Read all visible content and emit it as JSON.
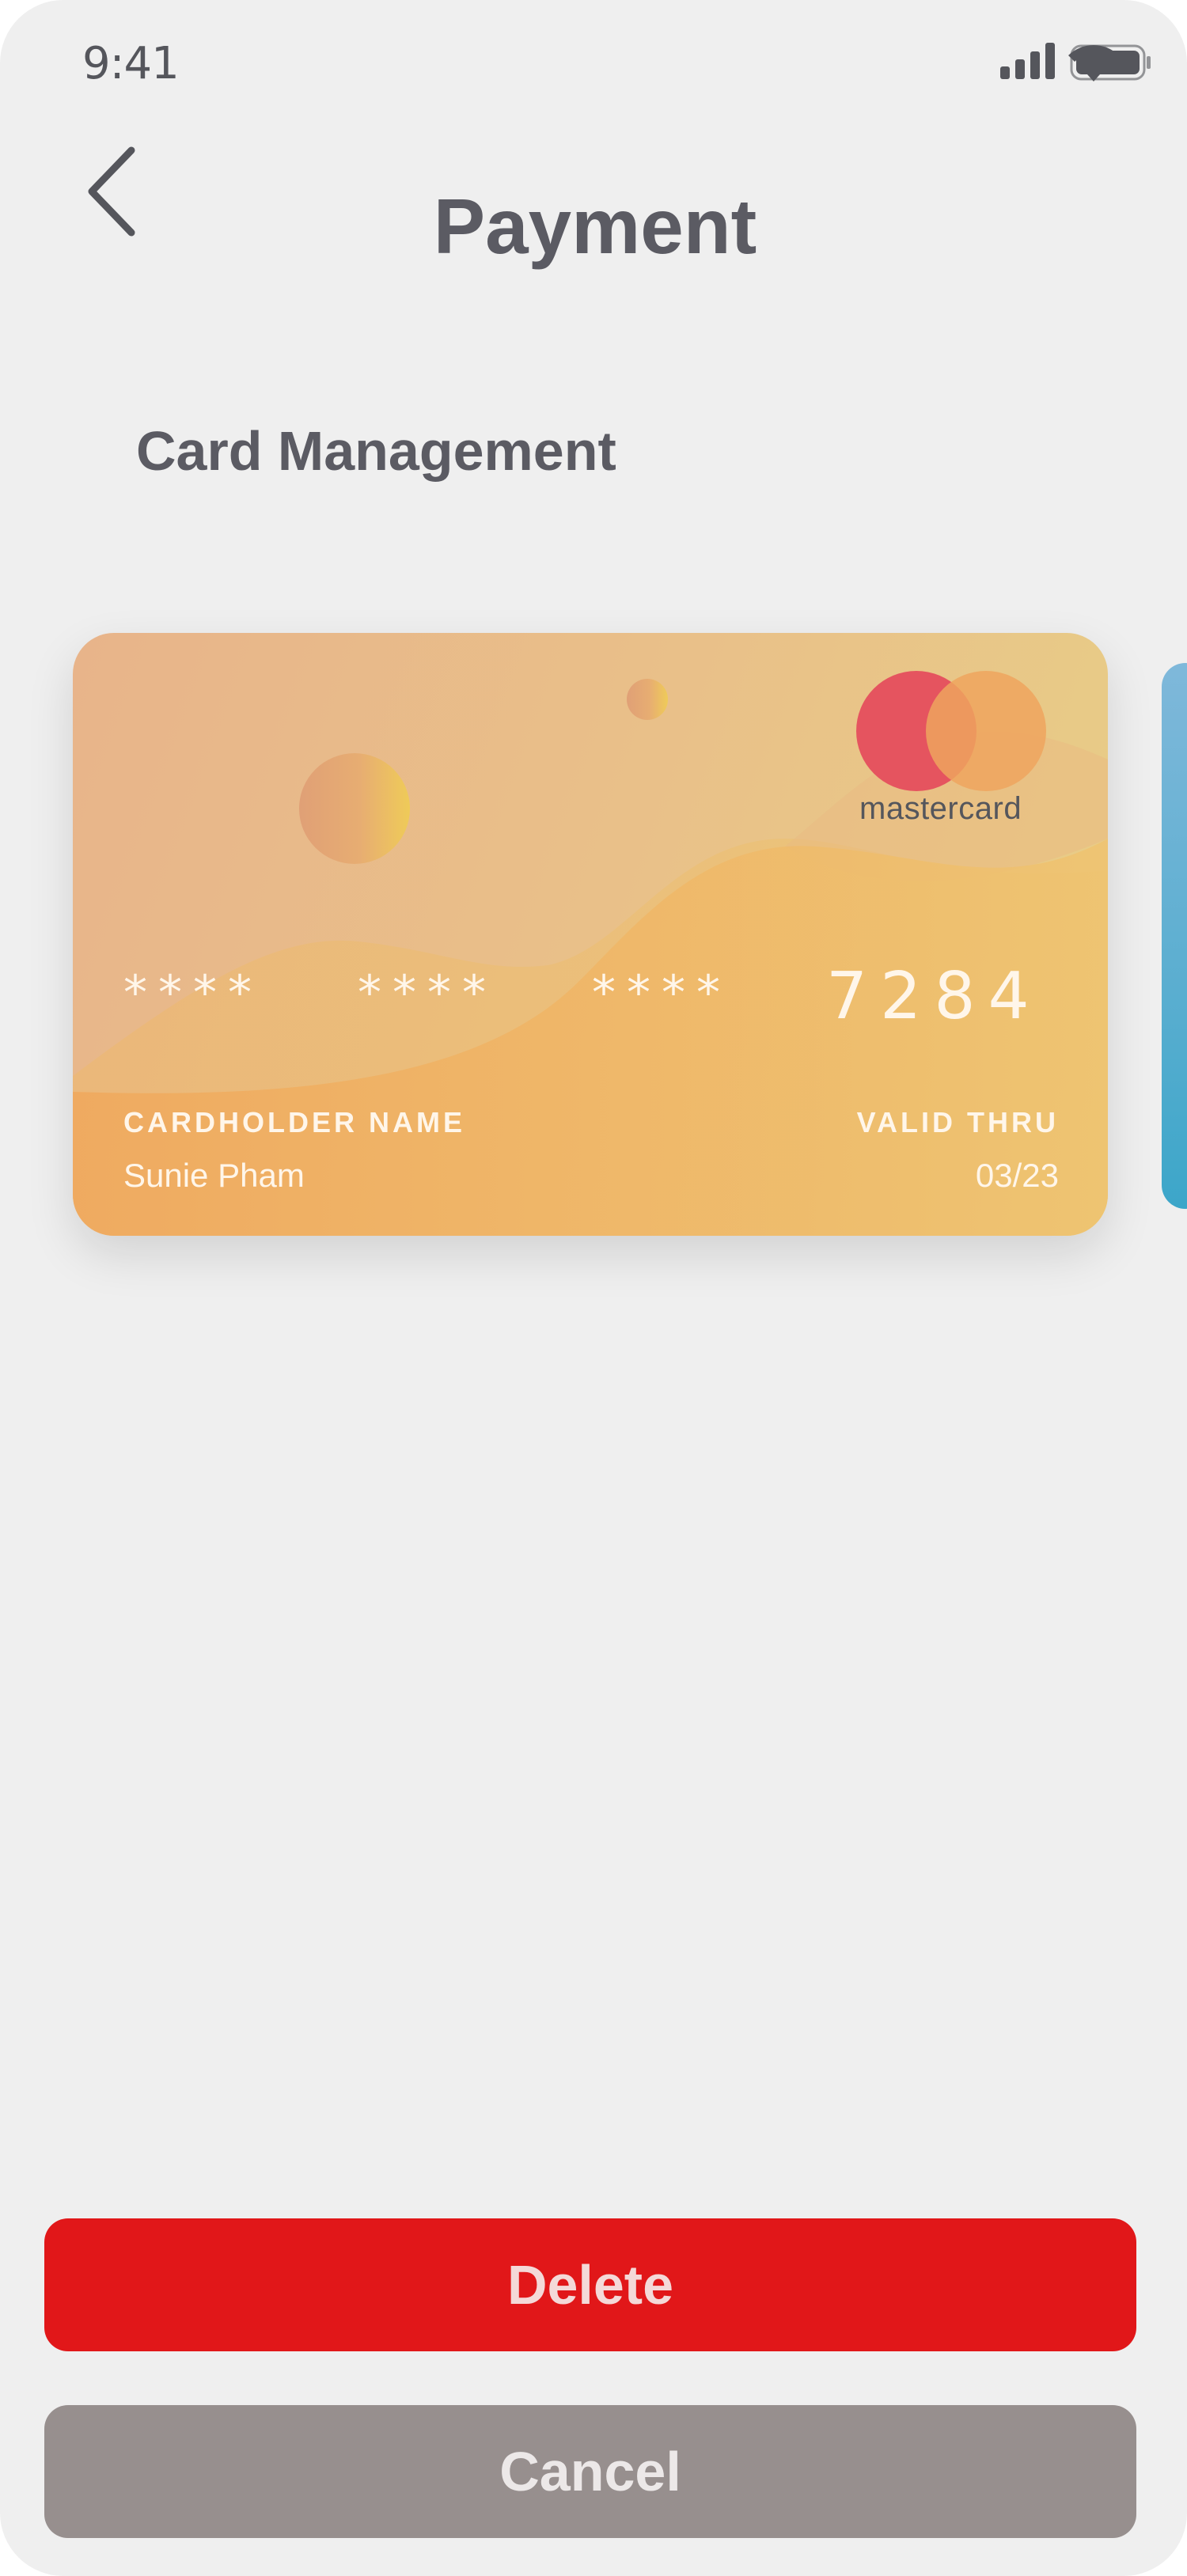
{
  "status_bar": {
    "time": "9:41",
    "icons": [
      "signal-icon",
      "wifi-icon",
      "battery-icon"
    ]
  },
  "header": {
    "title": "Payment",
    "back_icon": "chevron-left-icon"
  },
  "section": {
    "title": "Card Management"
  },
  "card": {
    "masked_groups": [
      "****",
      "****",
      "****"
    ],
    "last4": "7284",
    "cardholder_label": "CARDHOLDER NAME",
    "cardholder_name": "Sunie Pham",
    "valid_label": "VALID THRU",
    "valid_value": "03/23",
    "brand": "mastercard",
    "colors": {
      "mc_red": "#e5545f",
      "mc_orange": "#eea55e",
      "card_accent": "#efb35e"
    }
  },
  "actions": {
    "delete_label": "Delete",
    "cancel_label": "Cancel"
  },
  "colors": {
    "delete": "#e11719",
    "cancel": "#978f8e",
    "background": "#efefef"
  }
}
